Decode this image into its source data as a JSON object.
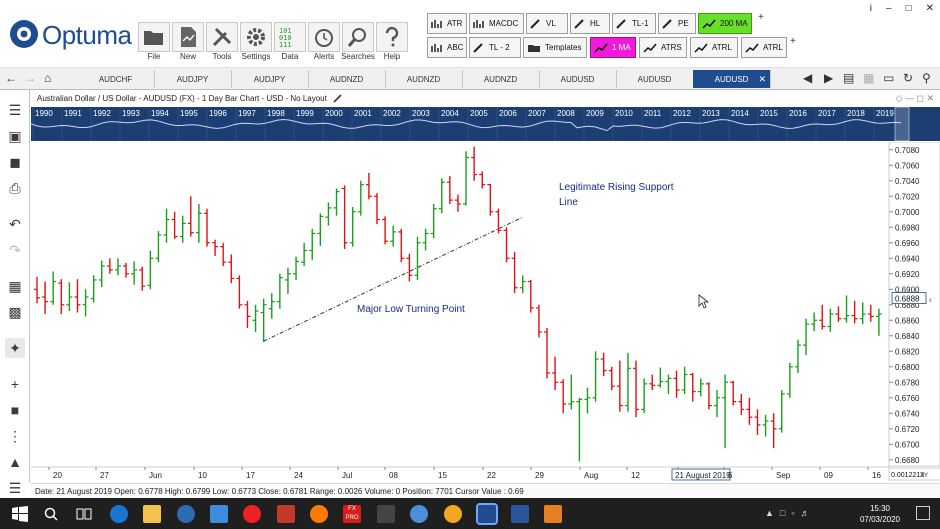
{
  "app": {
    "logo_text": "Optuma",
    "main_buttons": [
      {
        "label": "File",
        "icon": "folder-icon"
      },
      {
        "label": "New",
        "icon": "new-file-icon"
      },
      {
        "label": "Tools",
        "icon": "tools-icon"
      },
      {
        "label": "Settings",
        "icon": "gear-icon"
      },
      {
        "label": "Data",
        "icon": "binary-data-icon"
      },
      {
        "label": "Alerts",
        "icon": "alarm-clock-icon"
      },
      {
        "label": "Searches",
        "icon": "magnifier-icon"
      },
      {
        "label": "Help",
        "icon": "help-icon"
      }
    ],
    "tool_row1": [
      "ATR",
      "MACDC",
      "VL",
      "HL",
      "TL-1",
      "PE",
      "200 MA"
    ],
    "tool_row2": [
      "ABC",
      "TL - 2",
      "Templates",
      "1 MA",
      "ATRS",
      "ATRL",
      "ATRL"
    ],
    "window_controls": [
      "i",
      "–",
      "□",
      "✕"
    ]
  },
  "tabs": [
    "AUDCHF",
    "AUDJPY",
    "AUDJPY",
    "AUDNZD",
    "AUDNZD",
    "AUDNZD",
    "AUDUSD",
    "AUDUSD",
    "AUDUSD"
  ],
  "active_tab_index": 8,
  "chart_header": "Australian Dollar / US Dollar - AUDUSD (FX) - 1 Day Bar Chart - USD - No Layout",
  "year_strip": [
    "1990",
    "1991",
    "1992",
    "1993",
    "1994",
    "1995",
    "1996",
    "1997",
    "1998",
    "1999",
    "2000",
    "2001",
    "2002",
    "2003",
    "2004",
    "2005",
    "2006",
    "2007",
    "2008",
    "2009",
    "2010",
    "2011",
    "2012",
    "2013",
    "2014",
    "2015",
    "2016",
    "2017",
    "2018",
    "2019"
  ],
  "annotations": {
    "support_label_1": "Legitimate Rising Support",
    "support_label_2": "Line",
    "low_label": "Major Low Turning Point"
  },
  "chart_data": {
    "type": "ohlc-bar",
    "title": "Australian Dollar / US Dollar - AUDUSD (FX) - 1 Day Bar Chart - USD - No Layout",
    "x_ticks": [
      "20",
      "27",
      "Jun",
      "10",
      "17",
      "24",
      "Jul",
      "08",
      "15",
      "22",
      "29",
      "Aug",
      "12",
      "21 August 2019",
      "6",
      "Sep",
      "09",
      "16"
    ],
    "y_ticks": [
      "0.7080",
      "0.7060",
      "0.7040",
      "0.7020",
      "0.7000",
      "0.6980",
      "0.6960",
      "0.6940",
      "0.6920",
      "0.6900",
      "0.6880",
      "0.6860",
      "0.6840",
      "0.6820",
      "0.6800",
      "0.6780",
      "0.6760",
      "0.6740",
      "0.6720",
      "0.6700",
      "0.6680"
    ],
    "ylim": [
      0.6672,
      0.709
    ],
    "last_price": "0.6888",
    "bottom_right_value": "0.0012213",
    "support_line": {
      "from": {
        "x": "17",
        "y": 0.6833
      },
      "to": {
        "x": "29",
        "y": 0.6993
      }
    },
    "bars": [
      {
        "o": 0.69,
        "h": 0.6916,
        "l": 0.6882,
        "c": 0.6889
      },
      {
        "o": 0.689,
        "h": 0.691,
        "l": 0.6868,
        "c": 0.6884
      },
      {
        "o": 0.6884,
        "h": 0.6923,
        "l": 0.688,
        "c": 0.691
      },
      {
        "o": 0.6908,
        "h": 0.6913,
        "l": 0.6868,
        "c": 0.688
      },
      {
        "o": 0.688,
        "h": 0.6909,
        "l": 0.6872,
        "c": 0.689
      },
      {
        "o": 0.689,
        "h": 0.6913,
        "l": 0.687,
        "c": 0.688
      },
      {
        "o": 0.688,
        "h": 0.69,
        "l": 0.6865,
        "c": 0.689
      },
      {
        "o": 0.6888,
        "h": 0.6918,
        "l": 0.6883,
        "c": 0.6912
      },
      {
        "o": 0.6912,
        "h": 0.6937,
        "l": 0.6903,
        "c": 0.693
      },
      {
        "o": 0.693,
        "h": 0.694,
        "l": 0.692,
        "c": 0.6925
      },
      {
        "o": 0.6925,
        "h": 0.694,
        "l": 0.6918,
        "c": 0.693
      },
      {
        "o": 0.693,
        "h": 0.6934,
        "l": 0.6915,
        "c": 0.692
      },
      {
        "o": 0.692,
        "h": 0.6936,
        "l": 0.6906,
        "c": 0.6925
      },
      {
        "o": 0.6925,
        "h": 0.6929,
        "l": 0.6898,
        "c": 0.6904
      },
      {
        "o": 0.6905,
        "h": 0.695,
        "l": 0.69,
        "c": 0.694
      },
      {
        "o": 0.694,
        "h": 0.6975,
        "l": 0.6935,
        "c": 0.697
      },
      {
        "o": 0.697,
        "h": 0.7004,
        "l": 0.696,
        "c": 0.699
      },
      {
        "o": 0.699,
        "h": 0.7,
        "l": 0.6965,
        "c": 0.6968
      },
      {
        "o": 0.6968,
        "h": 0.6995,
        "l": 0.696,
        "c": 0.6985
      },
      {
        "o": 0.6985,
        "h": 0.702,
        "l": 0.6968,
        "c": 0.6973
      },
      {
        "o": 0.6973,
        "h": 0.701,
        "l": 0.696,
        "c": 0.6998
      },
      {
        "o": 0.6998,
        "h": 0.7004,
        "l": 0.6955,
        "c": 0.696
      },
      {
        "o": 0.696,
        "h": 0.6964,
        "l": 0.6943,
        "c": 0.6955
      },
      {
        "o": 0.6955,
        "h": 0.696,
        "l": 0.693,
        "c": 0.6935
      },
      {
        "o": 0.6935,
        "h": 0.6945,
        "l": 0.6908,
        "c": 0.6914
      },
      {
        "o": 0.6914,
        "h": 0.6918,
        "l": 0.6875,
        "c": 0.688
      },
      {
        "o": 0.688,
        "h": 0.6885,
        "l": 0.685,
        "c": 0.6865
      },
      {
        "o": 0.686,
        "h": 0.688,
        "l": 0.6845,
        "c": 0.6872
      },
      {
        "o": 0.687,
        "h": 0.6888,
        "l": 0.6832,
        "c": 0.688
      },
      {
        "o": 0.6875,
        "h": 0.6895,
        "l": 0.6862,
        "c": 0.6884
      },
      {
        "o": 0.6884,
        "h": 0.692,
        "l": 0.6875,
        "c": 0.6915
      },
      {
        "o": 0.6912,
        "h": 0.6928,
        "l": 0.6894,
        "c": 0.692
      },
      {
        "o": 0.692,
        "h": 0.6942,
        "l": 0.6912,
        "c": 0.6936
      },
      {
        "o": 0.6935,
        "h": 0.696,
        "l": 0.693,
        "c": 0.695
      },
      {
        "o": 0.695,
        "h": 0.6978,
        "l": 0.6938,
        "c": 0.6972
      },
      {
        "o": 0.6972,
        "h": 0.6998,
        "l": 0.6956,
        "c": 0.6994
      },
      {
        "o": 0.6993,
        "h": 0.7012,
        "l": 0.6982,
        "c": 0.7005
      },
      {
        "o": 0.7005,
        "h": 0.703,
        "l": 0.6995,
        "c": 0.7026
      },
      {
        "o": 0.703,
        "h": 0.7034,
        "l": 0.6952,
        "c": 0.696
      },
      {
        "o": 0.696,
        "h": 0.7006,
        "l": 0.6955,
        "c": 0.7
      },
      {
        "o": 0.7,
        "h": 0.704,
        "l": 0.6995,
        "c": 0.7035
      },
      {
        "o": 0.7035,
        "h": 0.705,
        "l": 0.7016,
        "c": 0.702
      },
      {
        "o": 0.702,
        "h": 0.7024,
        "l": 0.6984,
        "c": 0.699
      },
      {
        "o": 0.699,
        "h": 0.6994,
        "l": 0.6958,
        "c": 0.6962
      },
      {
        "o": 0.6962,
        "h": 0.6982,
        "l": 0.6955,
        "c": 0.6974
      },
      {
        "o": 0.6974,
        "h": 0.6978,
        "l": 0.6935,
        "c": 0.694
      },
      {
        "o": 0.694,
        "h": 0.6946,
        "l": 0.691,
        "c": 0.6918
      },
      {
        "o": 0.6918,
        "h": 0.6968,
        "l": 0.6912,
        "c": 0.696
      },
      {
        "o": 0.696,
        "h": 0.6978,
        "l": 0.695,
        "c": 0.6972
      },
      {
        "o": 0.6972,
        "h": 0.701,
        "l": 0.6966,
        "c": 0.7004
      },
      {
        "o": 0.7004,
        "h": 0.7043,
        "l": 0.6998,
        "c": 0.7038
      },
      {
        "o": 0.7038,
        "h": 0.7046,
        "l": 0.701,
        "c": 0.7015
      },
      {
        "o": 0.7015,
        "h": 0.7022,
        "l": 0.7,
        "c": 0.701
      },
      {
        "o": 0.701,
        "h": 0.7078,
        "l": 0.7008,
        "c": 0.707
      },
      {
        "o": 0.707,
        "h": 0.7084,
        "l": 0.704,
        "c": 0.7048
      },
      {
        "o": 0.7048,
        "h": 0.7052,
        "l": 0.703,
        "c": 0.7035
      },
      {
        "o": 0.7035,
        "h": 0.7036,
        "l": 0.6995,
        "c": 0.7
      },
      {
        "o": 0.7,
        "h": 0.7004,
        "l": 0.6972,
        "c": 0.6976
      },
      {
        "o": 0.6976,
        "h": 0.698,
        "l": 0.6935,
        "c": 0.694
      },
      {
        "o": 0.694,
        "h": 0.6948,
        "l": 0.6895,
        "c": 0.6902
      },
      {
        "o": 0.6902,
        "h": 0.6918,
        "l": 0.6895,
        "c": 0.691
      },
      {
        "o": 0.691,
        "h": 0.6912,
        "l": 0.687,
        "c": 0.6876
      },
      {
        "o": 0.6876,
        "h": 0.688,
        "l": 0.6838,
        "c": 0.6845
      },
      {
        "o": 0.6845,
        "h": 0.685,
        "l": 0.6785,
        "c": 0.6792
      },
      {
        "o": 0.6792,
        "h": 0.6813,
        "l": 0.677,
        "c": 0.678
      },
      {
        "o": 0.678,
        "h": 0.6784,
        "l": 0.674,
        "c": 0.6752
      },
      {
        "o": 0.6752,
        "h": 0.679,
        "l": 0.6745,
        "c": 0.6755
      },
      {
        "o": 0.6755,
        "h": 0.676,
        "l": 0.6678,
        "c": 0.6758
      },
      {
        "o": 0.6758,
        "h": 0.6773,
        "l": 0.674,
        "c": 0.676
      },
      {
        "o": 0.676,
        "h": 0.682,
        "l": 0.6755,
        "c": 0.681
      },
      {
        "o": 0.681,
        "h": 0.6818,
        "l": 0.6788,
        "c": 0.6795
      },
      {
        "o": 0.6795,
        "h": 0.68,
        "l": 0.677,
        "c": 0.6775
      },
      {
        "o": 0.6775,
        "h": 0.6808,
        "l": 0.6742,
        "c": 0.675
      },
      {
        "o": 0.675,
        "h": 0.6818,
        "l": 0.6742,
        "c": 0.6798
      },
      {
        "o": 0.6798,
        "h": 0.6808,
        "l": 0.6735,
        "c": 0.6745
      },
      {
        "o": 0.6745,
        "h": 0.6785,
        "l": 0.674,
        "c": 0.6778
      },
      {
        "o": 0.6778,
        "h": 0.679,
        "l": 0.677,
        "c": 0.6776
      },
      {
        "o": 0.6776,
        "h": 0.6799,
        "l": 0.6773,
        "c": 0.6781
      },
      {
        "o": 0.6781,
        "h": 0.679,
        "l": 0.6765,
        "c": 0.6785
      },
      {
        "o": 0.6785,
        "h": 0.6795,
        "l": 0.676,
        "c": 0.677
      },
      {
        "o": 0.677,
        "h": 0.68,
        "l": 0.6765,
        "c": 0.679
      },
      {
        "o": 0.679,
        "h": 0.6792,
        "l": 0.6755,
        "c": 0.6768
      },
      {
        "o": 0.6768,
        "h": 0.6785,
        "l": 0.6762,
        "c": 0.6778
      },
      {
        "o": 0.6778,
        "h": 0.678,
        "l": 0.6745,
        "c": 0.675
      },
      {
        "o": 0.675,
        "h": 0.677,
        "l": 0.6735,
        "c": 0.676
      },
      {
        "o": 0.676,
        "h": 0.679,
        "l": 0.6695,
        "c": 0.678
      },
      {
        "o": 0.678,
        "h": 0.6782,
        "l": 0.675,
        "c": 0.6755
      },
      {
        "o": 0.6755,
        "h": 0.6765,
        "l": 0.6738,
        "c": 0.6745
      },
      {
        "o": 0.6745,
        "h": 0.676,
        "l": 0.6725,
        "c": 0.6735
      },
      {
        "o": 0.6735,
        "h": 0.6745,
        "l": 0.6712,
        "c": 0.6725
      },
      {
        "o": 0.6725,
        "h": 0.6738,
        "l": 0.671,
        "c": 0.673
      },
      {
        "o": 0.673,
        "h": 0.674,
        "l": 0.6695,
        "c": 0.672
      },
      {
        "o": 0.672,
        "h": 0.677,
        "l": 0.6715,
        "c": 0.6765
      },
      {
        "o": 0.6765,
        "h": 0.6805,
        "l": 0.676,
        "c": 0.68
      },
      {
        "o": 0.68,
        "h": 0.6835,
        "l": 0.6792,
        "c": 0.6828
      },
      {
        "o": 0.6828,
        "h": 0.6862,
        "l": 0.6815,
        "c": 0.6855
      },
      {
        "o": 0.6855,
        "h": 0.687,
        "l": 0.6846,
        "c": 0.686
      },
      {
        "o": 0.686,
        "h": 0.688,
        "l": 0.6848,
        "c": 0.6852
      },
      {
        "o": 0.6852,
        "h": 0.6875,
        "l": 0.6845,
        "c": 0.6868
      },
      {
        "o": 0.6868,
        "h": 0.6878,
        "l": 0.6858,
        "c": 0.6862
      },
      {
        "o": 0.6862,
        "h": 0.6892,
        "l": 0.6857,
        "c": 0.6866
      },
      {
        "o": 0.6866,
        "h": 0.6885,
        "l": 0.6856,
        "c": 0.6862
      },
      {
        "o": 0.6862,
        "h": 0.6883,
        "l": 0.6855,
        "c": 0.6868
      },
      {
        "o": 0.6868,
        "h": 0.688,
        "l": 0.6858,
        "c": 0.6865
      },
      {
        "o": 0.6865,
        "h": 0.6875,
        "l": 0.684,
        "c": 0.6868
      }
    ],
    "colors": {
      "up": "#1a9e1a",
      "down": "#e01010"
    }
  },
  "status_bar": "Date: 21 August 2019 Open: 0.6778 High: 0.6799 Low: 0.6773 Close: 0.6781 Range: 0.0026 Volume: 0 Position: 7701 Cursor Value : 0.69",
  "xy_label": "XY",
  "taskbar": {
    "time": "15:30",
    "date": "07/03/2020",
    "fx_label": "FX PRO"
  },
  "colors": {
    "accent": "#1e4c8f",
    "year_strip": "#1c3f73",
    "green_button": "#66e02a",
    "magenta_button": "#f21ad9"
  }
}
